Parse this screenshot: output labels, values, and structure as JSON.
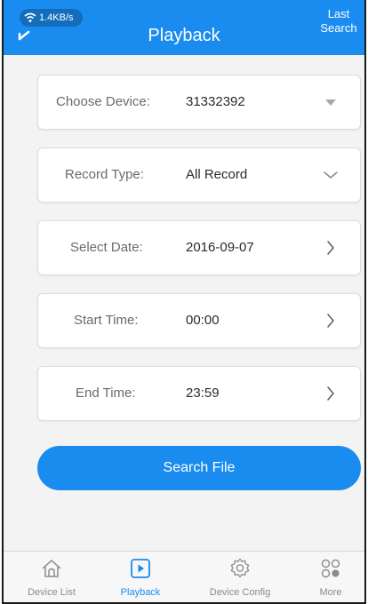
{
  "status": {
    "network_speed": "1.4KB/s"
  },
  "header": {
    "title": "Playback",
    "last_search_line1": "Last",
    "last_search_line2": "Search"
  },
  "form": {
    "fields": [
      {
        "label": "Choose Device:",
        "value": "31332392",
        "control": "dropdown-filled"
      },
      {
        "label": "Record Type:",
        "value": "All Record",
        "control": "dropdown-chevron"
      },
      {
        "label": "Select Date:",
        "value": "2016-09-07",
        "control": "chevron-right"
      },
      {
        "label": "Start Time:",
        "value": "00:00",
        "control": "chevron-right"
      },
      {
        "label": "End Time:",
        "value": "23:59",
        "control": "chevron-right"
      }
    ]
  },
  "search_button": {
    "label": "Search File"
  },
  "bottom_nav": {
    "items": [
      {
        "label": "Device List",
        "icon": "home-icon",
        "active": false
      },
      {
        "label": "Playback",
        "icon": "playback-icon",
        "active": true
      },
      {
        "label": "Device Config",
        "icon": "gear-icon",
        "active": false
      },
      {
        "label": "More",
        "icon": "more-icon",
        "active": false
      }
    ]
  },
  "colors": {
    "accent": "#1a8cf0",
    "background": "#f3f3f3",
    "card": "#ffffff"
  }
}
